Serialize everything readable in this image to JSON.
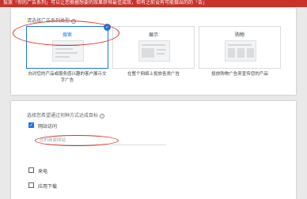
{
  "banner": {
    "text": "投放「你的广告系列」可以让您根据想要的效果获得最佳成效，但有之前设有可能做出的的「告」"
  },
  "goal_section": {
    "title": "请选择广告系列类型",
    "options": [
      {
        "label": "搜索",
        "description": "向对您的产品或服务感兴趣的客户展示文字广告",
        "selected": true
      },
      {
        "label": "展示",
        "description": "在整个网络上投放各类广告",
        "selected": false
      },
      {
        "label": "购物",
        "description": "投放购物广告来宣传您的产品",
        "selected": false
      }
    ]
  },
  "results_section": {
    "title": "选择您希望通过何种方式达成目标",
    "website_visits": {
      "label": "网站访问",
      "checked": true
    },
    "url_field": {
      "placeholder": "您的商家网站"
    },
    "phone_calls": {
      "label": "来电",
      "checked": false
    },
    "app_downloads": {
      "label": "应用下载",
      "checked": false
    }
  },
  "colors": {
    "accent": "#1a73e8",
    "annotation": "#d93025",
    "banner": "#c8322a"
  }
}
